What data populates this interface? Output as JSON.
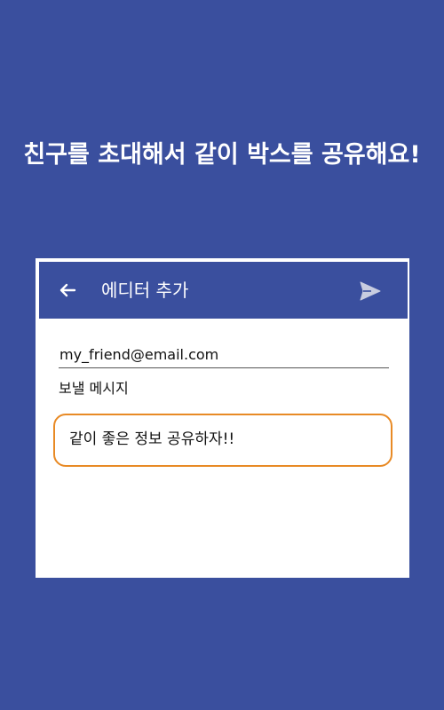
{
  "headline": "친구를 초대해서 같이 박스를 공유해요!",
  "app_bar": {
    "title": "에디터 추가",
    "back_icon": "arrow-left-icon",
    "send_icon": "send-icon"
  },
  "form": {
    "email_value": "my_friend@email.com",
    "message_label": "보낼 메시지",
    "message_value": "같이 좋은 정보 공유하자!!"
  },
  "colors": {
    "background": "#3a4f9e",
    "app_bar": "#3a4f9e",
    "highlight_border": "#e88a25"
  }
}
